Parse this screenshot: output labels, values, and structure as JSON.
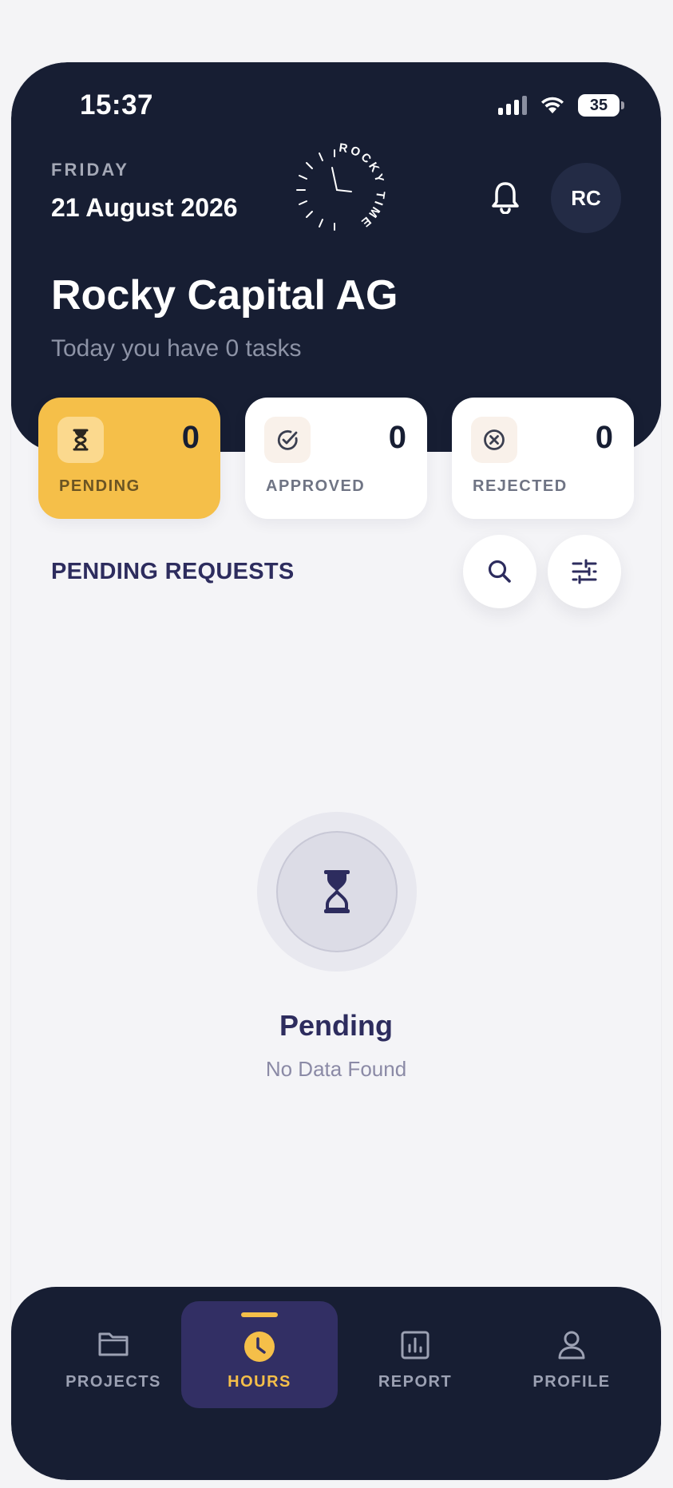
{
  "status_bar": {
    "time": "15:37",
    "battery": "35"
  },
  "header": {
    "day": "FRIDAY",
    "date": "21 August 2026",
    "logo_text": "ROCKY TIME",
    "avatar_initials": "RC",
    "company": "Rocky Capital AG",
    "subtitle": "Today you have 0 tasks"
  },
  "stats": [
    {
      "label": "PENDING",
      "count": "0",
      "icon": "hourglass-icon",
      "active": true
    },
    {
      "label": "APPROVED",
      "count": "0",
      "icon": "check-circle-icon",
      "active": false
    },
    {
      "label": "REJECTED",
      "count": "0",
      "icon": "x-circle-icon",
      "active": false
    }
  ],
  "section": {
    "title": "PENDING REQUESTS"
  },
  "empty_state": {
    "title": "Pending",
    "message": "No Data Found"
  },
  "nav": {
    "items": [
      {
        "label": "PROJECTS",
        "icon": "folder-icon",
        "active": false
      },
      {
        "label": "HOURS",
        "icon": "clock-icon",
        "active": true
      },
      {
        "label": "REPORT",
        "icon": "bar-chart-icon",
        "active": false
      },
      {
        "label": "PROFILE",
        "icon": "user-icon",
        "active": false
      }
    ]
  },
  "colors": {
    "navy": "#171e33",
    "accent": "#f5bf49",
    "indigo": "#2d2c5e",
    "background": "#f4f4f7"
  }
}
